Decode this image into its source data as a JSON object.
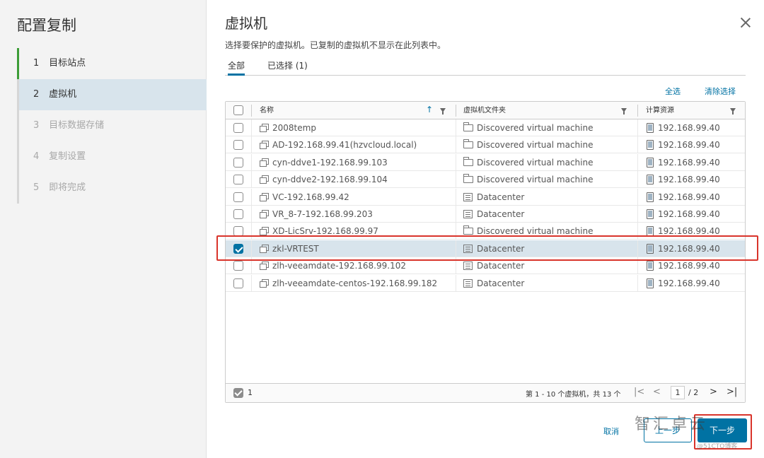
{
  "sidebar": {
    "title": "配置复制",
    "steps": [
      {
        "num": "1",
        "label": "目标站点"
      },
      {
        "num": "2",
        "label": "虚拟机"
      },
      {
        "num": "3",
        "label": "目标数据存储"
      },
      {
        "num": "4",
        "label": "复制设置"
      },
      {
        "num": "5",
        "label": "即将完成"
      }
    ]
  },
  "main": {
    "title": "虚拟机",
    "subtitle": "选择要保护的虚拟机。已复制的虚拟机不显示在此列表中。",
    "tabs": [
      {
        "label": "全部"
      },
      {
        "label": "已选择 (1)"
      }
    ],
    "actions": {
      "select_all": "全选",
      "clear": "清除选择"
    }
  },
  "grid": {
    "columns": [
      "名称",
      "虚拟机文件夹",
      "计算资源"
    ],
    "rows": [
      {
        "name": "2008temp",
        "folder": "Discovered virtual machine",
        "folder_icon": "folder-icon",
        "resource": "192.168.99.40",
        "checked": false
      },
      {
        "name": "AD-192.168.99.41(hzvcloud.local)",
        "folder": "Discovered virtual machine",
        "folder_icon": "folder-icon",
        "resource": "192.168.99.40",
        "checked": false
      },
      {
        "name": "cyn-ddve1-192.168.99.103",
        "folder": "Discovered virtual machine",
        "folder_icon": "folder-icon",
        "resource": "192.168.99.40",
        "checked": false
      },
      {
        "name": "cyn-ddve2-192.168.99.104",
        "folder": "Discovered virtual machine",
        "folder_icon": "folder-icon",
        "resource": "192.168.99.40",
        "checked": false
      },
      {
        "name": "VC-192.168.99.42",
        "folder": "Datacenter",
        "folder_icon": "datacenter-icon",
        "resource": "192.168.99.40",
        "checked": false
      },
      {
        "name": "VR_8-7-192.168.99.203",
        "folder": "Datacenter",
        "folder_icon": "datacenter-icon",
        "resource": "192.168.99.40",
        "checked": false
      },
      {
        "name": "XD-LicSrv-192.168.99.97",
        "folder": "Discovered virtual machine",
        "folder_icon": "folder-icon",
        "resource": "192.168.99.40",
        "checked": false
      },
      {
        "name": "zkl-VRTEST",
        "folder": "Datacenter",
        "folder_icon": "datacenter-icon",
        "resource": "192.168.99.40",
        "checked": true
      },
      {
        "name": "zlh-veeamdate-192.168.99.102",
        "folder": "Datacenter",
        "folder_icon": "datacenter-icon",
        "resource": "192.168.99.40",
        "checked": false
      },
      {
        "name": "zlh-veeamdate-centos-192.168.99.182",
        "folder": "Datacenter",
        "folder_icon": "datacenter-icon",
        "resource": "192.168.99.40",
        "checked": false
      }
    ],
    "footer": {
      "selected_count": "1",
      "range": "第 1 - 10 个虚拟机，共 13 个",
      "page": "1",
      "total_pages": "/ 2"
    }
  },
  "buttons": {
    "cancel": "取消",
    "back": "上一步",
    "next": "下一步"
  },
  "watermark": {
    "text": "智汇卓云",
    "sub": "@51CTO博客"
  },
  "colors": {
    "accent": "#0072a3",
    "highlight": "#d9342b",
    "done": "#3c9d37"
  }
}
